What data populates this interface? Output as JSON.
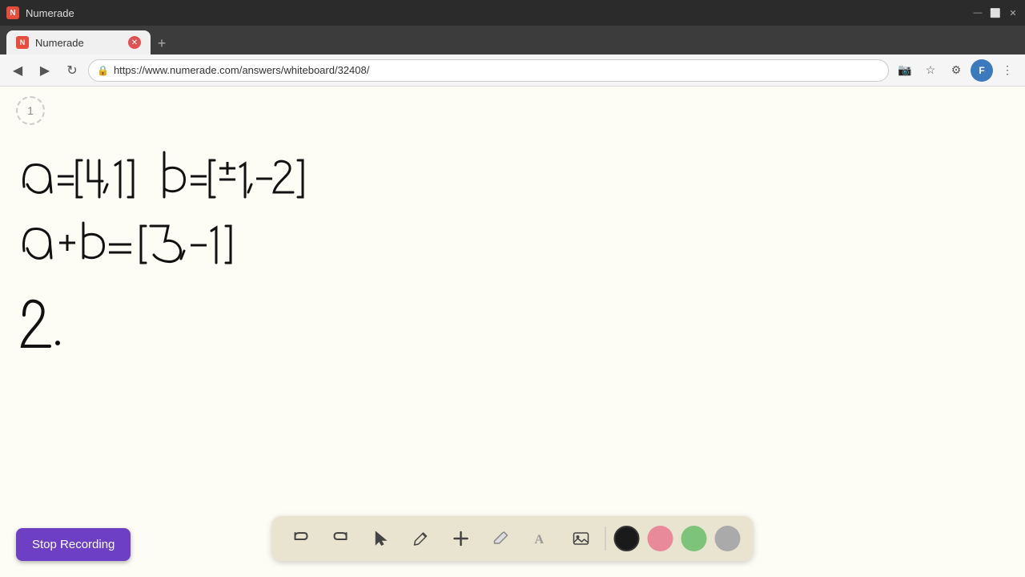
{
  "browser": {
    "title": "Numerade",
    "tab_label": "Numerade",
    "url": "https://www.numerade.com/answers/whiteboard/32408/",
    "new_tab_label": "+",
    "favicon_text": "N"
  },
  "nav": {
    "back_icon": "◀",
    "forward_icon": "▶",
    "refresh_icon": "↻",
    "lock_icon": "🔒",
    "star_icon": "☆",
    "camera_icon": "📷"
  },
  "window_controls": {
    "minimize": "—",
    "maximize": "⬜",
    "close": "✕"
  },
  "whiteboard": {
    "page_number": "1"
  },
  "toolbar": {
    "undo_icon": "↩",
    "redo_icon": "↪",
    "select_icon": "▲",
    "pencil_icon": "✏",
    "plus_icon": "+",
    "eraser_icon": "/",
    "text_icon": "A",
    "image_icon": "🖼",
    "colors": [
      {
        "name": "black",
        "hex": "#1a1a1a",
        "active": true
      },
      {
        "name": "pink",
        "hex": "#e88a9a",
        "active": false
      },
      {
        "name": "green",
        "hex": "#7dc47a",
        "active": false
      },
      {
        "name": "gray",
        "hex": "#aaaaaa",
        "active": false
      }
    ]
  },
  "stop_recording": {
    "label": "Stop Recording"
  }
}
